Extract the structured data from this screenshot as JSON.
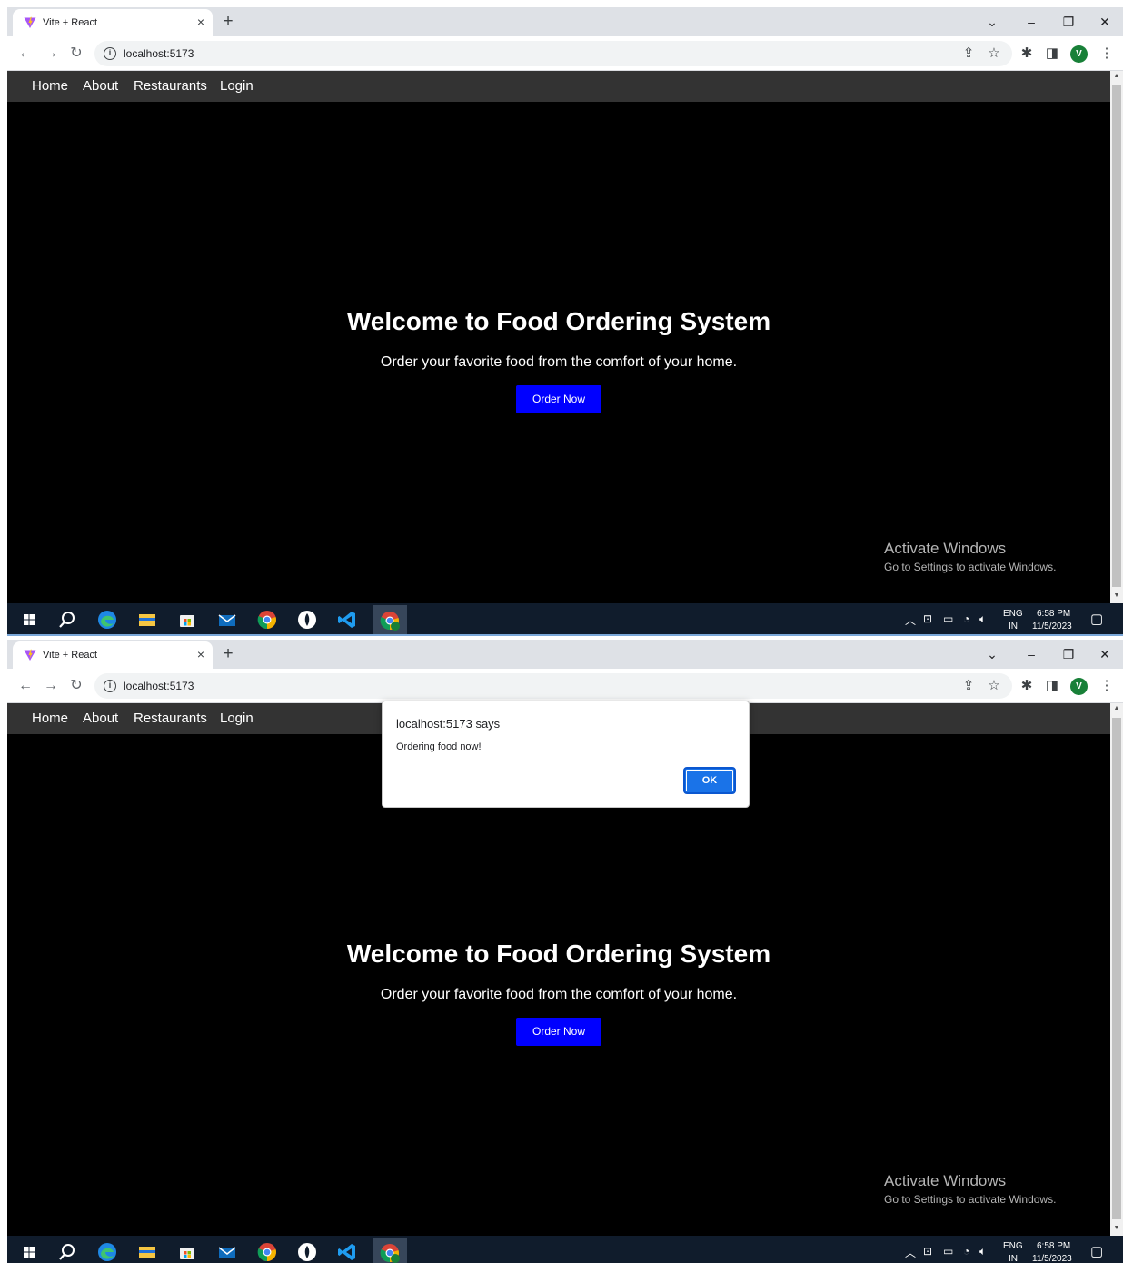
{
  "browser": {
    "tab_title": "Vite + React",
    "tab_close": "×",
    "new_tab": "+",
    "url": "localhost:5173",
    "profile_initial": "V",
    "icons": [
      "vite-favicon-icon",
      "back-arrow-icon",
      "forward-arrow-icon",
      "reload-icon",
      "info-icon",
      "share-icon",
      "star-icon",
      "extensions-icon",
      "side-panel-icon",
      "kebab-menu-icon"
    ],
    "window_controls": [
      "chevron-down-icon",
      "minimize-icon",
      "restore-icon",
      "close-icon"
    ]
  },
  "page": {
    "nav": [
      "Home",
      "About",
      "Restaurants",
      "Login"
    ],
    "heading": "Welcome to Food Ordering System",
    "subtitle": "Order your favorite food from the comfort of your home.",
    "button": "Order Now",
    "colors": {
      "background": "#000000",
      "navbar": "#333333",
      "button": "#0000ff"
    }
  },
  "watermark": {
    "title": "Activate Windows",
    "subtitle": "Go to Settings to activate Windows."
  },
  "dialog": {
    "title": "localhost:5173 says",
    "message": "Ordering food now!",
    "ok": "OK"
  },
  "taskbar": {
    "lang": "ENG",
    "region": "IN",
    "time": "6:58 PM",
    "date": "11/5/2023",
    "icons": [
      "windows-start-icon",
      "search-icon",
      "edge-icon",
      "file-explorer-icon",
      "store-icon",
      "mail-icon",
      "chrome-icon",
      "mongodb-compass-icon",
      "vscode-icon",
      "chrome-profile-icon"
    ]
  }
}
